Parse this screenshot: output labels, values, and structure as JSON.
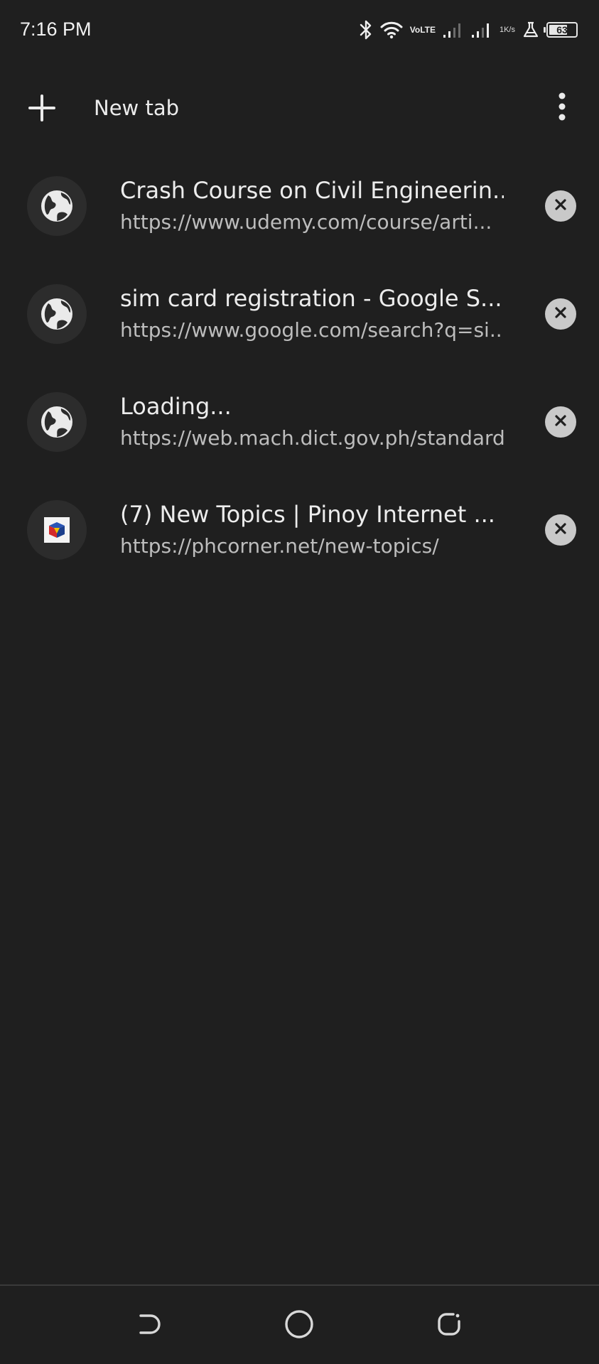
{
  "status_bar": {
    "time": "7:16 PM",
    "volte_top": "Vo",
    "volte_bottom": "LTE",
    "speed_value": "1",
    "speed_unit": "K/s",
    "battery_level": "63",
    "icons": [
      "bluetooth-icon",
      "wifi-icon",
      "volte-icon",
      "signal-icon",
      "signal-icon",
      "data-speed",
      "flask-icon",
      "battery-icon"
    ]
  },
  "toolbar": {
    "new_tab_label": "New tab",
    "plus_icon": "plus-icon",
    "menu_icon": "more-vertical-icon"
  },
  "tabs": [
    {
      "title": "Crash Course on Civil Engineerin...",
      "url": "https://www.udemy.com/course/arti...",
      "favicon": "globe-icon"
    },
    {
      "title": "sim card registration - Google S...",
      "url": "https://www.google.com/search?q=si...",
      "favicon": "globe-icon"
    },
    {
      "title": "Loading...",
      "url": "https://web.mach.dict.gov.ph/standard",
      "favicon": "globe-icon"
    },
    {
      "title": "(7) New Topics | Pinoy Internet ...",
      "url": "https://phcorner.net/new-topics/",
      "favicon": "phcorner-logo-icon"
    }
  ],
  "nav_bar": {
    "icons": [
      "back-icon",
      "home-icon",
      "recents-icon"
    ]
  },
  "colors": {
    "background": "#1f1f1f",
    "text_primary": "#ececec",
    "text_secondary": "#bdbdbd",
    "favicon_bg": "#2c2c2c",
    "close_bg": "#c9c9c9"
  }
}
